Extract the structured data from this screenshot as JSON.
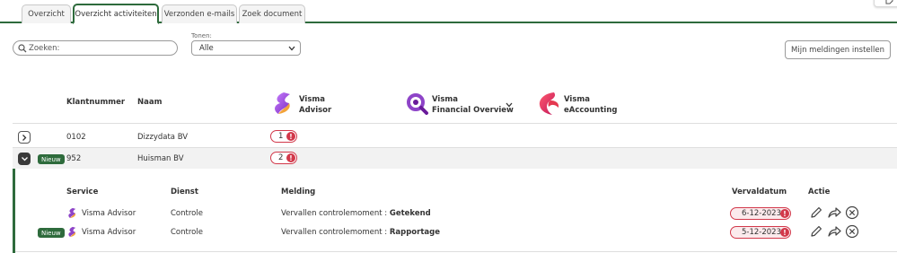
{
  "tabs": [
    {
      "label": "Overzicht",
      "active": false
    },
    {
      "label": "Overzicht activiteiten",
      "active": true
    },
    {
      "label": "Verzonden e-mails",
      "active": false
    },
    {
      "label": "Zoek document",
      "active": false
    }
  ],
  "toolbar": {
    "search_placeholder": "Zoeken:",
    "filter_label": "Tonen:",
    "filter_value": "Alle",
    "notifications_button": "Mijn meldingen instellen"
  },
  "table": {
    "headers": {
      "client_number": "Klantnummer",
      "name": "Naam"
    },
    "products": [
      {
        "line1": "Visma",
        "line2": "Advisor"
      },
      {
        "line1": "Visma",
        "line2": "Financial Overview"
      },
      {
        "line1": "Visma",
        "line2": "eAccounting"
      }
    ],
    "rows": [
      {
        "number": "0102",
        "name": "Dizzydata BV",
        "count": "1",
        "new_badge": "",
        "expanded": false
      },
      {
        "number": "952",
        "name": "Huisman BV",
        "count": "2",
        "new_badge": "Nieuw",
        "expanded": true
      }
    ]
  },
  "detail": {
    "headers": {
      "service": "Service",
      "dienst": "Dienst",
      "melding": "Melding",
      "vervaldatum": "Vervaldatum",
      "actie": "Actie"
    },
    "rows": [
      {
        "new_badge": "",
        "service": "Visma Advisor",
        "dienst": "Controle",
        "melding_prefix": "Vervallen controlemoment : ",
        "melding_bold": "Getekend",
        "date": "6-12-2023"
      },
      {
        "new_badge": "Nieuw",
        "service": "Visma Advisor",
        "dienst": "Controle",
        "melding_prefix": "Vervallen controlemoment : ",
        "melding_bold": "Rapportage",
        "date": "5-12-2023"
      }
    ]
  },
  "colors": {
    "accent": "#2e6b3c",
    "alert": "#d2384a"
  },
  "icons": [
    "search-icon",
    "chevron-down-icon",
    "chevron-right-icon",
    "alert-icon",
    "edit-icon",
    "forward-icon",
    "close-circle-icon",
    "visma-advisor-logo",
    "visma-financial-overview-logo",
    "visma-eaccounting-logo"
  ]
}
